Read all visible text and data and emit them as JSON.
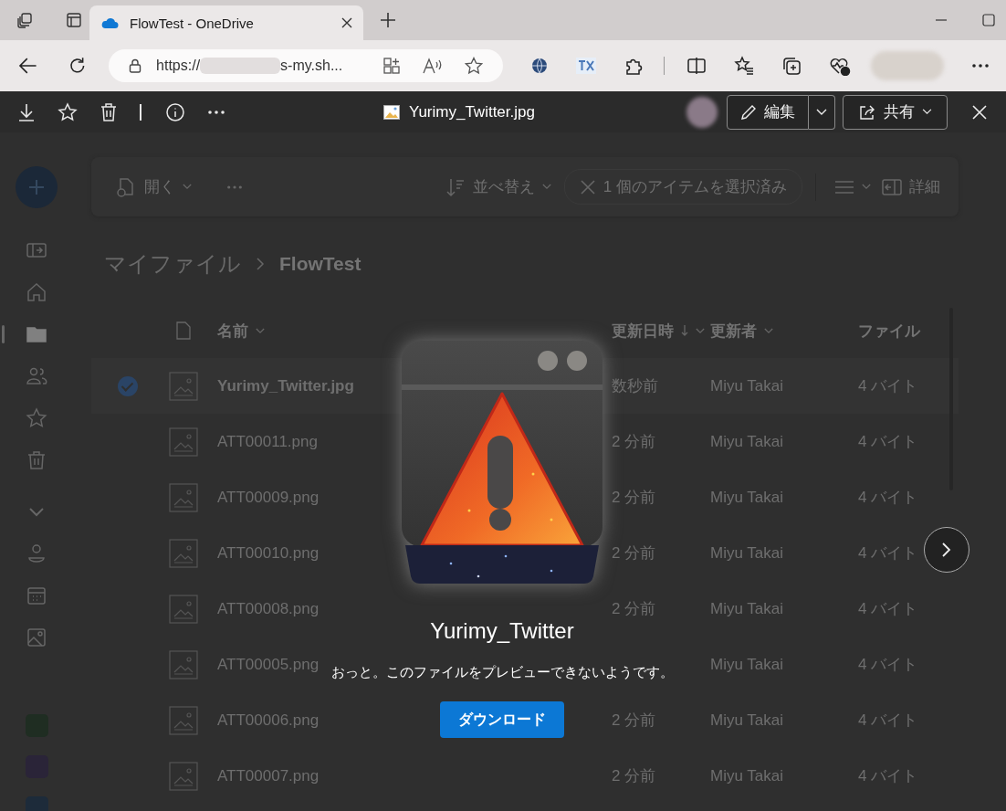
{
  "browser": {
    "tab": {
      "title": "FlowTest - OneDrive"
    },
    "url": {
      "scheme": "https://",
      "rest": "s-my.sh..."
    }
  },
  "viewer": {
    "file_name": "Yurimy_Twitter.jpg",
    "edit_button": "編集",
    "share_button": "共有",
    "preview": {
      "title": "Yurimy_Twitter",
      "message": "おっと。このファイルをプレビューできないようです。",
      "download_button": "ダウンロード"
    }
  },
  "background": {
    "sidebar": {
      "items": [
        {
          "kind": "panel",
          "selected": false
        },
        {
          "kind": "home",
          "selected": false
        },
        {
          "kind": "folder",
          "selected": true
        },
        {
          "kind": "people",
          "selected": false
        },
        {
          "kind": "star",
          "selected": false
        },
        {
          "kind": "trash",
          "selected": false
        },
        {
          "kind": "expand",
          "selected": false
        },
        {
          "kind": "person",
          "selected": false
        },
        {
          "kind": "calendar",
          "selected": false
        },
        {
          "kind": "image",
          "selected": false
        }
      ],
      "tiles": [
        {
          "color": "#1f2d22"
        },
        {
          "color": "#2a2438"
        },
        {
          "color": "#1d2b3a"
        }
      ]
    },
    "commands": {
      "open": "開く",
      "sort": "並べ替え",
      "selection": "1 個のアイテムを選択済み",
      "details": "詳細"
    },
    "breadcrumb": [
      "マイファイル",
      "FlowTest"
    ],
    "columns": {
      "name": "名前",
      "modified": "更新日時",
      "modified_by": "更新者",
      "size": "ファイル"
    },
    "rows": [
      {
        "name": "Yurimy_Twitter.jpg",
        "modified": "数秒前",
        "modified_by": "Miyu Takai",
        "size": "4 バイト",
        "selected": true
      },
      {
        "name": "ATT00011.png",
        "modified": "2 分前",
        "modified_by": "Miyu Takai",
        "size": "4 バイト",
        "selected": false
      },
      {
        "name": "ATT00009.png",
        "modified": "2 分前",
        "modified_by": "Miyu Takai",
        "size": "4 バイト",
        "selected": false
      },
      {
        "name": "ATT00010.png",
        "modified": "2 分前",
        "modified_by": "Miyu Takai",
        "size": "4 バイト",
        "selected": false
      },
      {
        "name": "ATT00008.png",
        "modified": "2 分前",
        "modified_by": "Miyu Takai",
        "size": "4 バイト",
        "selected": false
      },
      {
        "name": "ATT00005.png",
        "modified_by": "Miyu Takai",
        "size": "4 バイト",
        "selected": false
      },
      {
        "name": "ATT00006.png",
        "modified": "2 分前",
        "modified_by": "Miyu Takai",
        "size": "4 バイト",
        "selected": false
      },
      {
        "name": "ATT00007.png",
        "modified": "2 分前",
        "modified_by": "Miyu Takai",
        "size": "4 バイト",
        "selected": false
      }
    ]
  }
}
